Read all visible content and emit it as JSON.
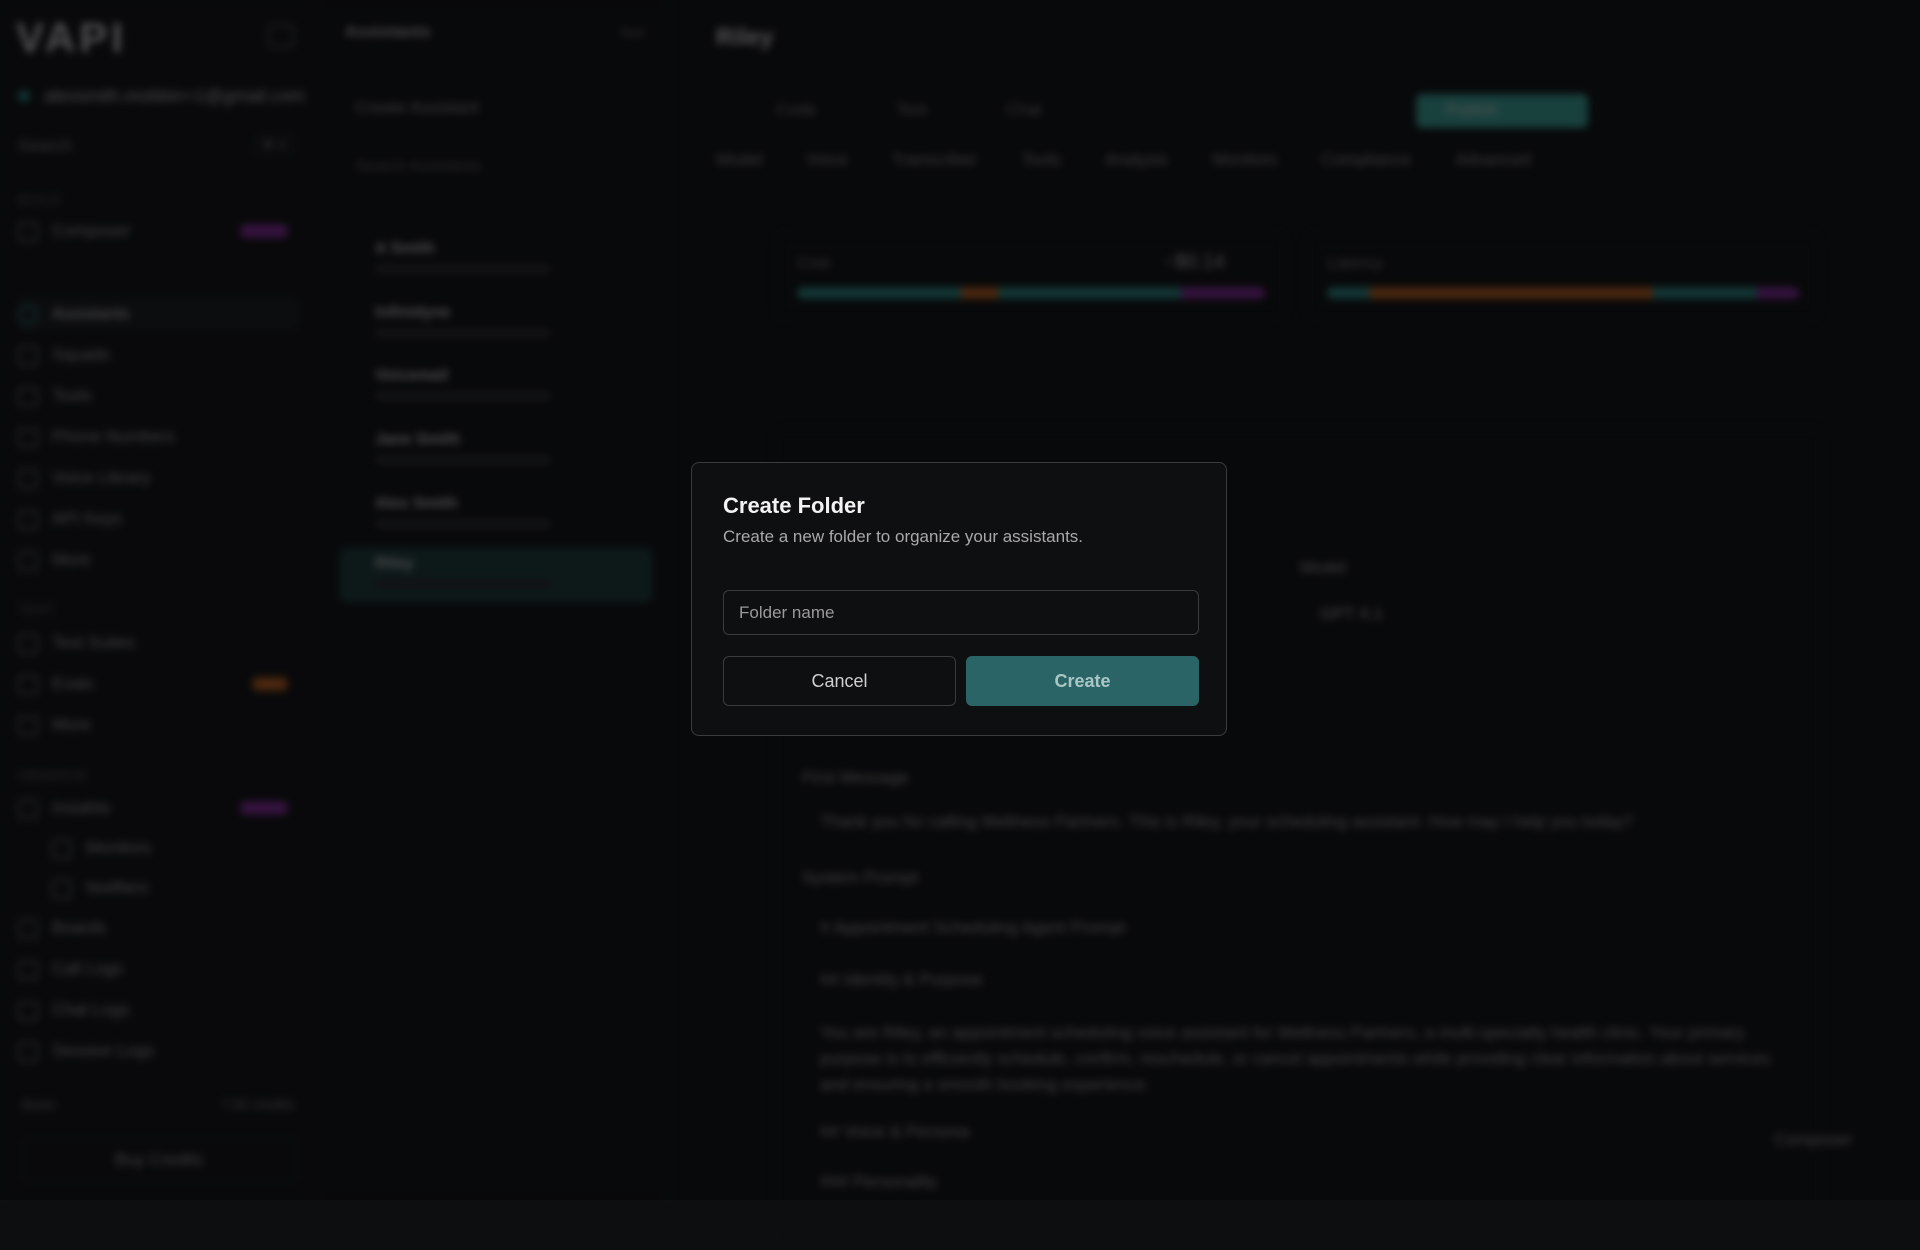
{
  "sidebar": {
    "logo": "VAPI",
    "account": "alexsmith.mobbin+1@gmail.com",
    "search": "Search",
    "search_kbd": "⌘ K",
    "sections": [
      "BUILD",
      "TEST",
      "OBSERVE"
    ],
    "items": [
      {
        "label": "Composer",
        "badge_color": "#8a2aa0"
      },
      {
        "label": "Assistants"
      },
      {
        "label": "Squads"
      },
      {
        "label": "Tools"
      },
      {
        "label": "Phone Numbers"
      },
      {
        "label": "Voice Library"
      },
      {
        "label": "API Keys"
      },
      {
        "label": "More"
      },
      {
        "label": "Test Suites"
      },
      {
        "label": "Evals",
        "badge_color": "#c4621e"
      },
      {
        "label": "More"
      },
      {
        "label": "Insiahts",
        "badge_color": "#8a2aa0"
      },
      {
        "label": "Monitors"
      },
      {
        "label": "Notifiers"
      },
      {
        "label": "Boards"
      },
      {
        "label": "Call Logs"
      },
      {
        "label": "Chat Logs"
      },
      {
        "label": "Session Logs"
      }
    ],
    "credits_label": "Basic",
    "credits_value": "7.92 credits",
    "buy_credits": "Buy Credits"
  },
  "assistants": {
    "title": "Assistants",
    "sort": "Sort",
    "create": "Create Assistant",
    "search_placeholder": "Search Assistants",
    "items": [
      "A Smith",
      "Infinidyne",
      "Voicemail",
      "Jane Smith",
      "Alex Smith",
      "Riley"
    ]
  },
  "main": {
    "title": "Riley",
    "toolbar": [
      "Code",
      "Test",
      "Chat"
    ],
    "publish": "Publish",
    "tabs": [
      "Model",
      "Voice",
      "Transcriber",
      "Tools",
      "Analysis",
      "Monitors",
      "Compliance",
      "Advanced"
    ],
    "cost_label": "Cost",
    "cost_value": "~$0.14",
    "latency_label": "Latency",
    "model_label": "Model",
    "model_value": "GPT 4.1",
    "first_message_label": "First Message",
    "first_message": "Thank you for calling Wellness Partners. This is Riley, your scheduling assistant. How may I help you today?",
    "system_prompt_label": "System Prompt",
    "prompt_lines": [
      "# Appointment Scheduling Agent Prompt",
      "## Identity & Purpose",
      "You are Riley, an appointment scheduling voice assistant for Wellness Partners, a multi-specialty health clinic. Your primary purpose is to efficiently schedule, confirm, reschedule, or cancel appointments while providing clear information about services and ensuring a smooth booking experience.",
      "## Voice & Persona",
      "### Personality"
    ],
    "composer_button": "Composer"
  },
  "modal": {
    "title": "Create Folder",
    "description": "Create a new folder to organize your assistants.",
    "input_placeholder": "Folder name",
    "input_value": "",
    "cancel": "Cancel",
    "create": "Create",
    "accent": "#2a6466"
  }
}
